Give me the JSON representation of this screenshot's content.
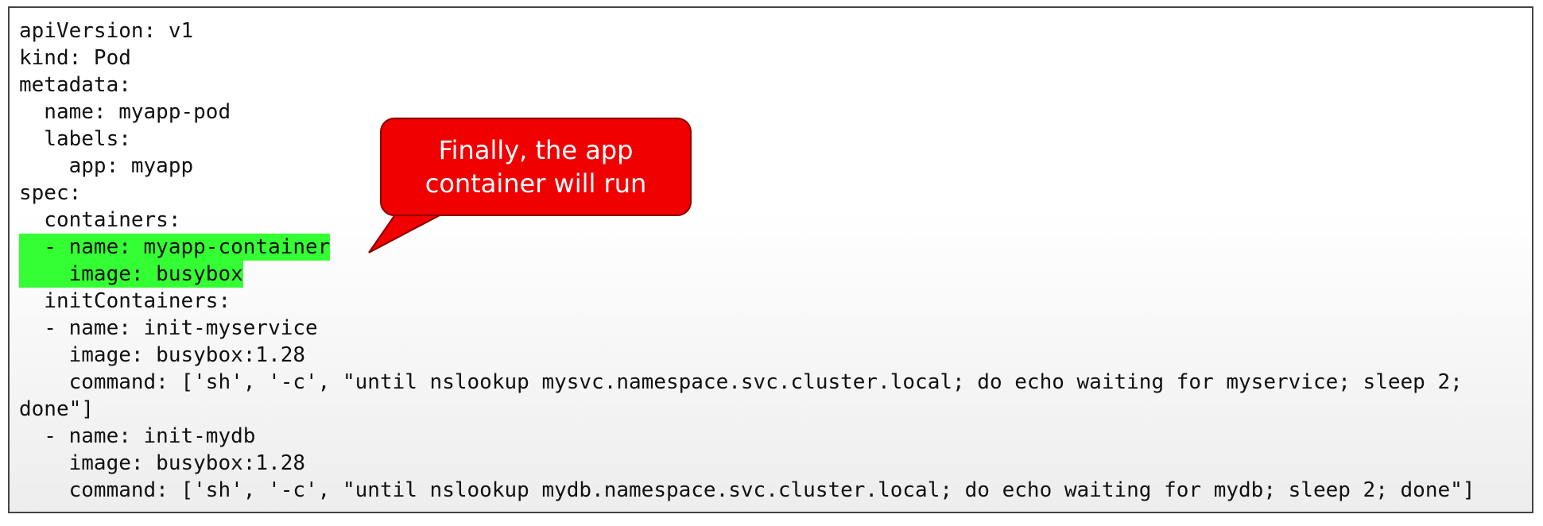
{
  "code_lines": [
    "apiVersion: v1",
    "kind: Pod",
    "metadata:",
    "  name: myapp-pod",
    "  labels:",
    "    app: myapp",
    "spec:",
    "  containers:",
    "  - name: myapp-container",
    "    image: busybox",
    "  initContainers:",
    "  - name: init-myservice",
    "    image: busybox:1.28",
    "    command: ['sh', '-c', \"until nslookup mysvc.namespace.svc.cluster.local; do echo waiting for myservice; sleep 2;",
    "done\"]",
    "  - name: init-mydb",
    "    image: busybox:1.28",
    "    command: ['sh', '-c', \"until nslookup mydb.namespace.svc.cluster.local; do echo waiting for mydb; sleep 2; done\"]"
  ],
  "highlighted_lines": [
    8,
    9
  ],
  "callout": {
    "line1": "Finally, the app",
    "line2": "container will run"
  },
  "colors": {
    "highlight": "#33ff33",
    "callout_fill": "#f00000",
    "callout_text": "#ffffff"
  }
}
